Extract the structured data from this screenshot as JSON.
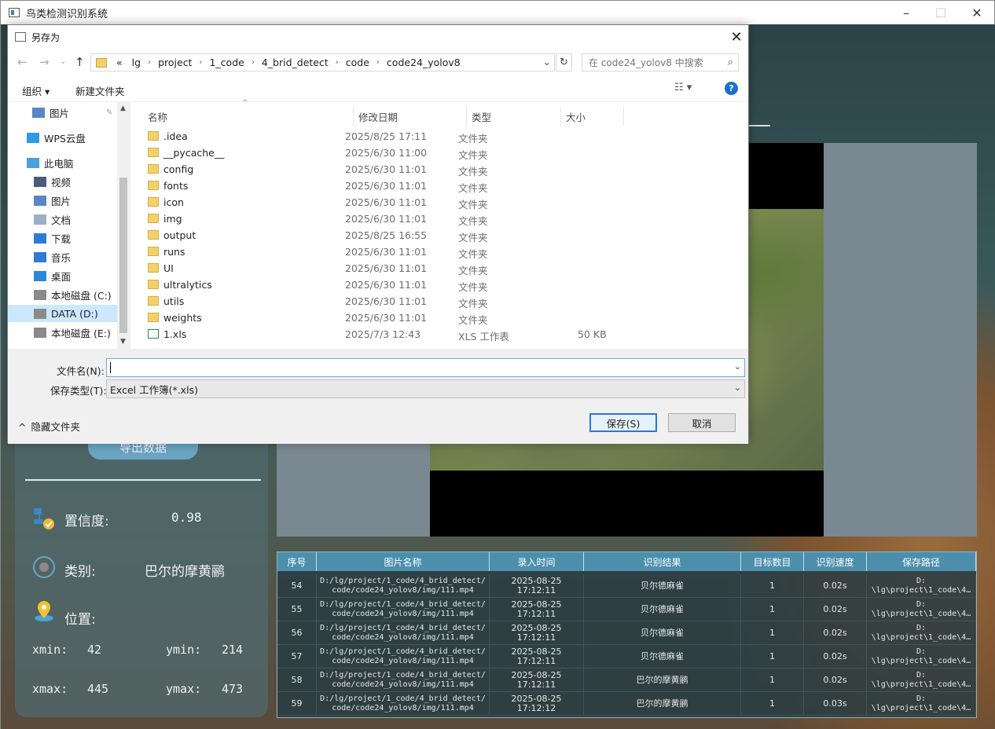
{
  "main_window": {
    "title": "鸟类检测识别系统",
    "export_button": "导出数据",
    "confidence_label": "置信度:",
    "confidence_value": "0.98",
    "class_label": "类别:",
    "class_value": "巴尔的摩黄鹂",
    "position_label": "位置:",
    "coords": {
      "xmin_label": "xmin:",
      "xmin": "42",
      "ymin_label": "ymin:",
      "ymin": "214",
      "xmax_label": "xmax:",
      "xmax": "445",
      "ymax_label": "ymax:",
      "ymax": "473"
    },
    "table": {
      "headers": [
        "序号",
        "图片名称",
        "录入时间",
        "识别结果",
        "目标数目",
        "识别速度",
        "保存路径"
      ],
      "rows": [
        {
          "id": "54",
          "name1": "D:/lg/project/1_code/4_brid_detect/",
          "name2": "code/code24_yolov8/img/111.mp4",
          "time1": "2025-08-25",
          "time2": "17:12:11",
          "result": "贝尔德麻雀",
          "count": "1",
          "speed": "0.02s",
          "path1": "D:",
          "path2": "\\lg\\project\\1_code\\4…"
        },
        {
          "id": "55",
          "name1": "D:/lg/project/1_code/4_brid_detect/",
          "name2": "code/code24_yolov8/img/111.mp4",
          "time1": "2025-08-25",
          "time2": "17:12:11",
          "result": "贝尔德麻雀",
          "count": "1",
          "speed": "0.02s",
          "path1": "D:",
          "path2": "\\lg\\project\\1_code\\4…"
        },
        {
          "id": "56",
          "name1": "D:/lg/project/1_code/4_brid_detect/",
          "name2": "code/code24_yolov8/img/111.mp4",
          "time1": "2025-08-25",
          "time2": "17:12:11",
          "result": "贝尔德麻雀",
          "count": "1",
          "speed": "0.02s",
          "path1": "D:",
          "path2": "\\lg\\project\\1_code\\4…"
        },
        {
          "id": "57",
          "name1": "D:/lg/project/1_code/4_brid_detect/",
          "name2": "code/code24_yolov8/img/111.mp4",
          "time1": "2025-08-25",
          "time2": "17:12:11",
          "result": "贝尔德麻雀",
          "count": "1",
          "speed": "0.02s",
          "path1": "D:",
          "path2": "\\lg\\project\\1_code\\4…"
        },
        {
          "id": "58",
          "name1": "D:/lg/project/1_code/4_brid_detect/",
          "name2": "code/code24_yolov8/img/111.mp4",
          "time1": "2025-08-25",
          "time2": "17:12:11",
          "result": "巴尔的摩黄鹂",
          "count": "1",
          "speed": "0.02s",
          "path1": "D:",
          "path2": "\\lg\\project\\1_code\\4…"
        },
        {
          "id": "59",
          "name1": "D:/lg/project/1_code/4_brid_detect/",
          "name2": "code/code24_yolov8/img/111.mp4",
          "time1": "2025-08-25",
          "time2": "17:12:12",
          "result": "巴尔的摩黄鹂",
          "count": "1",
          "speed": "0.03s",
          "path1": "D:",
          "path2": "\\lg\\project\\1_code\\4…"
        }
      ]
    }
  },
  "dialog": {
    "title": "另存为",
    "breadcrumb": [
      "«",
      "lg",
      "project",
      "1_code",
      "4_brid_detect",
      "code",
      "code24_yolov8"
    ],
    "search_placeholder": "在 code24_yolov8 中搜索",
    "toolbar": {
      "organize": "组织 ▾",
      "new_folder": "新建文件夹"
    },
    "nav_items": [
      {
        "label": "图片",
        "icon": "pictures-icon",
        "pinned": true
      },
      {
        "label": "WPS云盘",
        "icon": "cloud-icon"
      },
      {
        "label": "此电脑",
        "icon": "computer-icon"
      },
      {
        "label": "视频",
        "icon": "video-icon"
      },
      {
        "label": "图片",
        "icon": "pictures-icon"
      },
      {
        "label": "文档",
        "icon": "document-icon"
      },
      {
        "label": "下载",
        "icon": "download-icon"
      },
      {
        "label": "音乐",
        "icon": "music-icon"
      },
      {
        "label": "桌面",
        "icon": "desktop-icon"
      },
      {
        "label": "本地磁盘 (C:)",
        "icon": "drive-icon"
      },
      {
        "label": "DATA (D:)",
        "icon": "drive-icon",
        "selected": true
      },
      {
        "label": "本地磁盘 (E:)",
        "icon": "drive-icon"
      }
    ],
    "columns": {
      "name": "名称",
      "modified": "修改日期",
      "type": "类型",
      "size": "大小"
    },
    "files": [
      {
        "name": ".idea",
        "date": "2025/8/25 17:11",
        "type": "文件夹",
        "size": ""
      },
      {
        "name": "__pycache__",
        "date": "2025/6/30 11:00",
        "type": "文件夹",
        "size": ""
      },
      {
        "name": "config",
        "date": "2025/6/30 11:01",
        "type": "文件夹",
        "size": ""
      },
      {
        "name": "fonts",
        "date": "2025/6/30 11:01",
        "type": "文件夹",
        "size": ""
      },
      {
        "name": "icon",
        "date": "2025/6/30 11:01",
        "type": "文件夹",
        "size": ""
      },
      {
        "name": "img",
        "date": "2025/6/30 11:01",
        "type": "文件夹",
        "size": ""
      },
      {
        "name": "output",
        "date": "2025/8/25 16:55",
        "type": "文件夹",
        "size": ""
      },
      {
        "name": "runs",
        "date": "2025/6/30 11:01",
        "type": "文件夹",
        "size": ""
      },
      {
        "name": "UI",
        "date": "2025/6/30 11:01",
        "type": "文件夹",
        "size": ""
      },
      {
        "name": "ultralytics",
        "date": "2025/6/30 11:01",
        "type": "文件夹",
        "size": ""
      },
      {
        "name": "utils",
        "date": "2025/6/30 11:01",
        "type": "文件夹",
        "size": ""
      },
      {
        "name": "weights",
        "date": "2025/6/30 11:01",
        "type": "文件夹",
        "size": ""
      },
      {
        "name": "1.xls",
        "date": "2025/7/3 12:43",
        "type": "XLS 工作表",
        "size": "50 KB"
      }
    ],
    "filename_label": "文件名(N):",
    "filename_value": "",
    "filetype_label": "保存类型(T):",
    "filetype_value": "Excel 工作簿(*.xls)",
    "save_button": "保存(S)",
    "cancel_button": "取消",
    "hide_folders": "隐藏文件夹"
  }
}
